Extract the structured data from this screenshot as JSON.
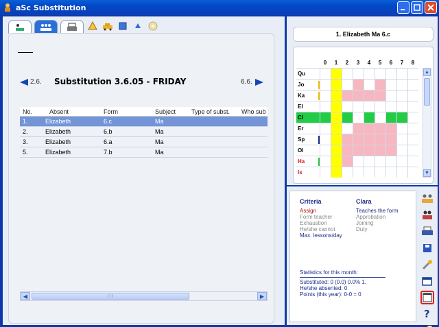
{
  "window": {
    "title": "aSc Substitution",
    "controls": [
      "minimize",
      "maximize",
      "close"
    ]
  },
  "toolbar": {
    "icons": [
      "teacher-view-icon",
      "group-icon",
      "print-icon",
      "alert-icon",
      "car-icon",
      "book-icon",
      "swap-icon",
      "cd-icon"
    ]
  },
  "nav": {
    "prev": "2.6.",
    "heading": "Substitution 3.6.05 - FRIDAY",
    "next": "6.6."
  },
  "table": {
    "columns": [
      "No.",
      "Absent",
      "Form",
      "Subject",
      "Type of subst.",
      "Who sub"
    ],
    "rows": [
      {
        "no": "1.",
        "absent": "Elizabeth",
        "form": "6.c",
        "subject": "Ma",
        "type": "",
        "who": ""
      },
      {
        "no": "2.",
        "absent": "Elizabeth",
        "form": "6.b",
        "subject": "Ma",
        "type": "",
        "who": ""
      },
      {
        "no": "3.",
        "absent": "Elizabeth",
        "form": "6.a",
        "subject": "Ma",
        "type": "",
        "who": ""
      },
      {
        "no": "5.",
        "absent": "Elizabeth",
        "form": "7.b",
        "subject": "Ma",
        "type": "",
        "who": ""
      }
    ]
  },
  "scroll_thumb_label": "III",
  "right": {
    "title": "1. Elizabeth Ma 6.c",
    "periods": [
      "0",
      "1",
      "2",
      "3",
      "4",
      "5",
      "6",
      "7",
      "8"
    ],
    "teachers": [
      {
        "name": "Qu",
        "red": false
      },
      {
        "name": "Jo",
        "red": false
      },
      {
        "name": "Ka",
        "red": false
      },
      {
        "name": "El",
        "red": false
      },
      {
        "name": "Cl",
        "red": false
      },
      {
        "name": "Er",
        "red": false
      },
      {
        "name": "Sp",
        "red": false
      },
      {
        "name": "Ol",
        "red": false
      },
      {
        "name": "Ha",
        "red": true
      },
      {
        "name": "Is",
        "red": true
      }
    ],
    "colors": {
      "yellow": "#ffff00",
      "pink": "#f7b7c0",
      "green": "#22cc44",
      "blue": "#1a2d88"
    }
  },
  "criteria": {
    "head_left": "Criteria",
    "head_right": "Clara",
    "left": [
      "Assign",
      "Form teacher",
      "Exhaustion",
      "He/she cannot",
      "Max. lessons/day"
    ],
    "right": [
      "Teaches the form",
      "Approbation",
      "Joining",
      "Duty"
    ],
    "stats_title": "Statistics for this month:",
    "substituted": "Substituted:       0 (0.0)   0.0%  1.",
    "absented": "He/she absented:   0",
    "points": "Points (this year): 0-0 = 0"
  },
  "side_icons": [
    "group-icon",
    "teachers-icon",
    "printer-icon",
    "save-icon",
    "tools-icon",
    "window-icon",
    "blank-window-icon",
    "help-icon",
    "exit-icon"
  ]
}
